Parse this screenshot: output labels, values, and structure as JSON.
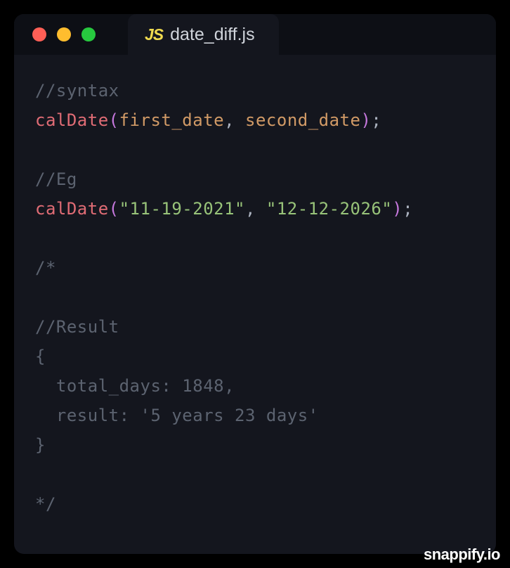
{
  "tab": {
    "badge": "JS",
    "filename": "date_diff.js"
  },
  "code": {
    "line1_comment": "//syntax",
    "line2_fn": "calDate",
    "line2_paren_open": "(",
    "line2_arg1": "first_date",
    "line2_comma": ", ",
    "line2_arg2": "second_date",
    "line2_paren_close": ")",
    "line2_semi": ";",
    "line4_comment": "//Eg",
    "line5_fn": "calDate",
    "line5_paren_open": "(",
    "line5_str1": "\"11-19-2021\"",
    "line5_comma": ", ",
    "line5_str2": "\"12-12-2026\"",
    "line5_paren_close": ")",
    "line5_semi": ";",
    "line7_comment": "/*",
    "line9_comment": "//Result",
    "line10_comment": "{",
    "line11_comment": "  total_days: 1848,",
    "line12_comment": "  result: '5 years 23 days'",
    "line13_comment": "}",
    "line15_comment": "*/"
  },
  "watermark": "snappify.io"
}
